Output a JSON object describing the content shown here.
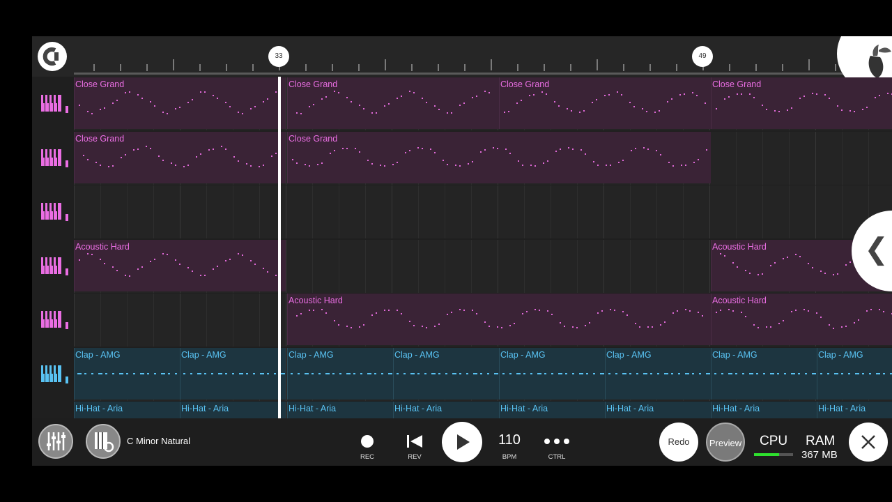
{
  "ruler": {
    "markers": [
      "33",
      "49"
    ]
  },
  "tracks": [
    {
      "icon": "piano-icon",
      "color": "#ea6ee3",
      "clips": [
        {
          "name": "Close Grand",
          "type": "purple"
        },
        {
          "name": "Close Grand",
          "type": "purple"
        },
        {
          "name": "Close Grand",
          "type": "purple"
        },
        {
          "name": "Close Grand",
          "type": "purple"
        }
      ]
    },
    {
      "icon": "piano-icon",
      "color": "#ea6ee3",
      "clips": [
        {
          "name": "Close Grand",
          "type": "purple"
        },
        {
          "name": "Close Grand",
          "type": "purple"
        }
      ]
    },
    {
      "icon": "piano-icon",
      "color": "#ea6ee3",
      "clips": []
    },
    {
      "icon": "piano-icon",
      "color": "#ea6ee3",
      "clips": [
        {
          "name": "Acoustic Hard",
          "type": "purple"
        },
        {
          "name": "Acoustic Hard",
          "type": "purple"
        }
      ]
    },
    {
      "icon": "piano-icon",
      "color": "#ea6ee3",
      "clips": [
        {
          "name": "Acoustic Hard",
          "type": "purple"
        },
        {
          "name": "Acoustic Hard",
          "type": "purple"
        }
      ]
    },
    {
      "icon": "drum-icon",
      "color": "#59c2f2",
      "clips": [
        {
          "name": "Clap - AMG",
          "type": "blue"
        },
        {
          "name": "Clap - AMG",
          "type": "blue"
        },
        {
          "name": "Clap - AMG",
          "type": "blue"
        },
        {
          "name": "Clap - AMG",
          "type": "blue"
        },
        {
          "name": "Clap - AMG",
          "type": "blue"
        },
        {
          "name": "Clap - AMG",
          "type": "blue"
        },
        {
          "name": "Clap - AMG",
          "type": "blue"
        },
        {
          "name": "Clap - AMG",
          "type": "blue"
        }
      ]
    },
    {
      "icon": "drum-icon",
      "color": "#59c2f2",
      "clips": [
        {
          "name": "Hi-Hat - Aria",
          "type": "blue"
        },
        {
          "name": "Hi-Hat - Aria",
          "type": "blue"
        },
        {
          "name": "Hi-Hat - Aria",
          "type": "blue"
        },
        {
          "name": "Hi-Hat - Aria",
          "type": "blue"
        },
        {
          "name": "Hi-Hat - Aria",
          "type": "blue"
        },
        {
          "name": "Hi-Hat - Aria",
          "type": "blue"
        },
        {
          "name": "Hi-Hat - Aria",
          "type": "blue"
        },
        {
          "name": "Hi-Hat - Aria",
          "type": "blue"
        }
      ]
    }
  ],
  "transport": {
    "scale": "C Minor Natural",
    "rec_label": "REC",
    "rev_label": "REV",
    "bpm": "110",
    "bpm_label": "BPM",
    "ctrl_label": "CTRL",
    "redo_label": "Redo",
    "preview_label": "Preview",
    "cpu_label": "CPU",
    "cpu_level": 0.65,
    "ram_label": "RAM",
    "ram_value": "367 MB"
  },
  "colors": {
    "accent_purple": "#ea6ee3",
    "accent_blue": "#59c2f2",
    "cpu_green": "#2ee02e"
  }
}
